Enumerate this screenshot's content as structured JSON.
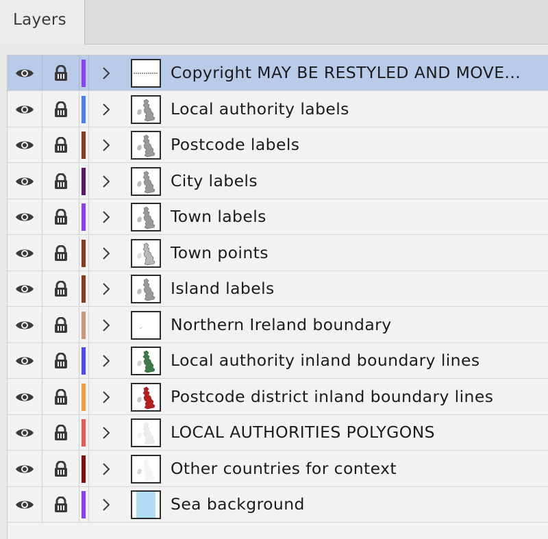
{
  "panel": {
    "tab_label": "Layers"
  },
  "layers": [
    {
      "name": "Copyright MAY BE RESTYLED AND MOVE...",
      "color": "#8a3ff5",
      "thumb": "line",
      "selected": true
    },
    {
      "name": "Local authority labels",
      "color": "#4c7ff0",
      "thumb": "blank",
      "selected": false
    },
    {
      "name": "Postcode labels",
      "color": "#8a3a1a",
      "thumb": "blank",
      "selected": false
    },
    {
      "name": "City labels",
      "color": "#5a1868",
      "thumb": "blank",
      "selected": false
    },
    {
      "name": "Town labels",
      "color": "#8a3ff5",
      "thumb": "blank",
      "selected": false
    },
    {
      "name": "Town points",
      "color": "#8a3a1a",
      "thumb": "map-gray",
      "selected": false
    },
    {
      "name": "Island labels",
      "color": "#8a3a1a",
      "thumb": "blank",
      "selected": false
    },
    {
      "name": "Northern Ireland boundary",
      "color": "#c9987a",
      "thumb": "dot",
      "selected": false
    },
    {
      "name": "Local authority inland boundary lines",
      "color": "#4a4cf0",
      "thumb": "map-green",
      "selected": false
    },
    {
      "name": "Postcode district inland boundary lines",
      "color": "#f0a040",
      "thumb": "map-red",
      "selected": false
    },
    {
      "name": "LOCAL AUTHORITIES POLYGONS",
      "color": "#e85a5a",
      "thumb": "map-faint",
      "selected": false
    },
    {
      "name": "Other countries for context",
      "color": "#7a1212",
      "thumb": "map-lightgray",
      "selected": false
    },
    {
      "name": "Sea background",
      "color": "#8a3ff5",
      "thumb": "sea",
      "selected": false
    }
  ],
  "icons": {
    "visibility": "eye-icon",
    "lock": "lock-icon",
    "expand": "chevron-right-icon"
  },
  "colors": {
    "selected_row": "#b8cbe9",
    "sea": "#b3dcf5"
  }
}
